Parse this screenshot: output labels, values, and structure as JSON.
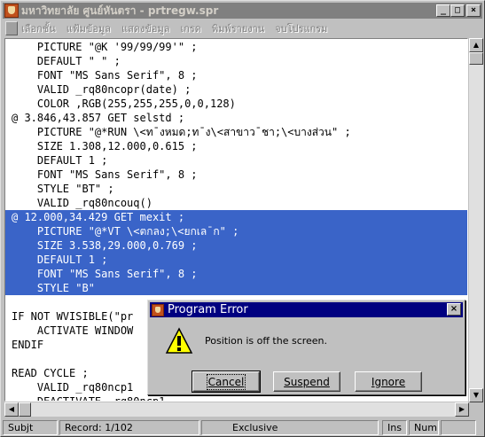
{
  "window": {
    "title": "มหาวิทยาลัย ศูนย์หันตรา - prtregw.spr"
  },
  "menubar": {
    "items": [
      "เลือกชั้น",
      "แฟ้มข้อมูล",
      "แสดงข้อมูล",
      "เกรด",
      "พิมพ์รายงาน",
      "จบโปรแกรม"
    ]
  },
  "code": {
    "lines": [
      "    PICTURE \"@K '99/99/99'\" ;",
      "    DEFAULT \" \" ;",
      "    FONT \"MS Sans Serif\", 8 ;",
      "    VALID _rq80ncopr(date) ;",
      "    COLOR ,RGB(255,255,255,0,0,128)",
      "@ 3.846,43.857 GET selstd ;",
      "    PICTURE \"@*RUN \\<ท¯งหมด;ท¯ง\\<สาขาว¯ชา;\\<บางส่วน\" ;",
      "    SIZE 1.308,12.000,0.615 ;",
      "    DEFAULT 1 ;",
      "    FONT \"MS Sans Serif\", 8 ;",
      "    STYLE \"BT\" ;",
      "    VALID _rq80ncouq()",
      "@ 12.000,34.429 GET mexit ;",
      "    PICTURE \"@*VT \\<ตกลง;\\<ยกเล¯ก\" ;",
      "    SIZE 3.538,29.000,0.769 ;",
      "    DEFAULT 1 ;",
      "    FONT \"MS Sans Serif\", 8 ;",
      "    STYLE \"B\"",
      "",
      "IF NOT WVISIBLE(\"pr",
      "    ACTIVATE WINDOW",
      "ENDIF",
      "",
      "READ CYCLE ;",
      "    VALID _rq80ncp1",
      "    DEACTIVATE _rq80ncp1"
    ]
  },
  "statusbar": {
    "subject": "Subjt",
    "record": "Record: 1/102",
    "mode": "Exclusive",
    "ins": "Ins",
    "num": "Num"
  },
  "dialog": {
    "title": "Program Error",
    "message": "Position is off the screen.",
    "cancel_label": "Cancel",
    "suspend_label": "Suspend",
    "ignore_label": "Ignore"
  },
  "icons": {
    "app": "fox-icon",
    "warning": "warning-icon"
  },
  "colors": {
    "selection": "#3a64c8",
    "dialog_title": "#000080"
  }
}
